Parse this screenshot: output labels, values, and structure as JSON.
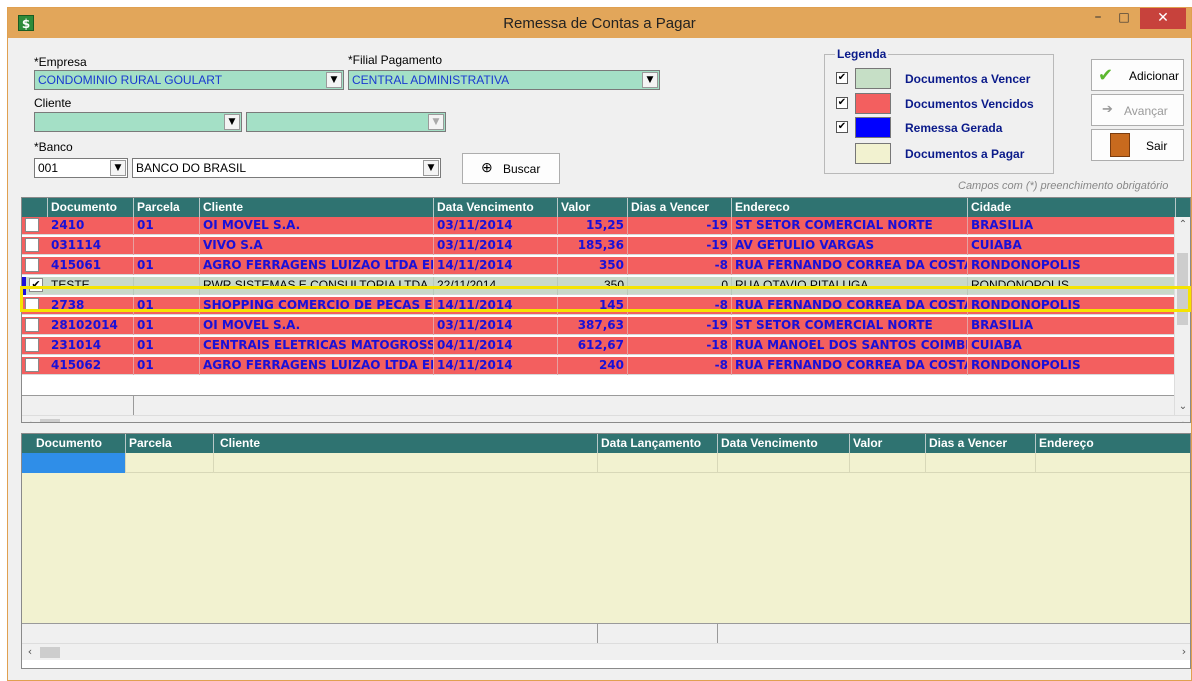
{
  "window": {
    "title": "Remessa de Contas a Pagar",
    "app_icon": "$",
    "minimize_label": "–",
    "maximize_label": "□",
    "close_label": "✕"
  },
  "form": {
    "empresa": {
      "label": "*Empresa",
      "value": "CONDOMINIO RURAL GOULART"
    },
    "filial": {
      "label": "*Filial Pagamento",
      "value": "CENTRAL ADMINISTRATIVA"
    },
    "cliente": {
      "label": "Cliente",
      "value": "",
      "value2": ""
    },
    "banco": {
      "label": "*Banco",
      "code": "001",
      "name": "BANCO DO BRASIL"
    },
    "buscar_label": "Buscar",
    "required_hint": "Campos com (*) preenchimento obrigatório"
  },
  "legend": {
    "title": "Legenda",
    "items": [
      {
        "label": "Documentos a Vencer",
        "color": "#c6dfc6",
        "checked": true
      },
      {
        "label": "Documentos Vencidos",
        "color": "#f35f5f",
        "checked": true
      },
      {
        "label": "Remessa Gerada",
        "color": "#0000ff",
        "checked": true
      },
      {
        "label": "Documentos a Pagar",
        "color": "#f2f2d0",
        "checked": false
      }
    ]
  },
  "actions": {
    "adicionar": "Adicionar",
    "avancar": "Avançar",
    "sair": "Sair"
  },
  "grid1": {
    "columns": [
      "Documento",
      "Parcela",
      "Cliente",
      "Data Vencimento",
      "Valor",
      "Dias a Vencer",
      "Endereco",
      "Cidade"
    ],
    "rows": [
      {
        "documento": "2410",
        "parcela": "01",
        "cliente": "OI MOVEL S.A.",
        "data_vencimento": "03/11/2014",
        "valor": "15,25",
        "dias": "-19",
        "endereco": "ST SETOR COMERCIAL NORTE",
        "cidade": "BRASILIA",
        "checked": false,
        "selected": false
      },
      {
        "documento": "031114",
        "parcela": "",
        "cliente": "VIVO S.A",
        "data_vencimento": "03/11/2014",
        "valor": "185,36",
        "dias": "-19",
        "endereco": "AV GETULIO VARGAS",
        "cidade": "CUIABA",
        "checked": false,
        "selected": false
      },
      {
        "documento": "415061",
        "parcela": "01",
        "cliente": "AGRO FERRAGENS LUIZAO LTDA EPP",
        "data_vencimento": "14/11/2014",
        "valor": "350",
        "dias": "-8",
        "endereco": "RUA FERNANDO CORREA DA COSTA",
        "cidade": "RONDONOPOLIS",
        "checked": false,
        "selected": false
      },
      {
        "documento": "TESTE",
        "parcela": "",
        "cliente": "RWR SISTEMAS E CONSULTORIA LTDA",
        "data_vencimento": "22/11/2014",
        "valor": "350",
        "dias": "0",
        "endereco": "RUA OTAVIO PITALUGA",
        "cidade": "RONDONOPOLIS",
        "checked": true,
        "selected": true
      },
      {
        "documento": "2738",
        "parcela": "01",
        "cliente": "SHOPPING COMERCIO DE PECAS E EQ",
        "data_vencimento": "14/11/2014",
        "valor": "145",
        "dias": "-8",
        "endereco": "RUA FERNANDO CORREA DA COSTA",
        "cidade": "RONDONOPOLIS",
        "checked": false,
        "selected": false
      },
      {
        "documento": "28102014",
        "parcela": "01",
        "cliente": "OI MOVEL S.A.",
        "data_vencimento": "03/11/2014",
        "valor": "387,63",
        "dias": "-19",
        "endereco": "ST SETOR COMERCIAL NORTE",
        "cidade": "BRASILIA",
        "checked": false,
        "selected": false
      },
      {
        "documento": "231014",
        "parcela": "01",
        "cliente": "CENTRAIS ELETRICAS MATOGROSSE",
        "data_vencimento": "04/11/2014",
        "valor": "612,67",
        "dias": "-18",
        "endereco": "RUA MANOEL DOS SANTOS COIMBRA",
        "cidade": "CUIABA",
        "checked": false,
        "selected": false
      },
      {
        "documento": "415062",
        "parcela": "01",
        "cliente": "AGRO FERRAGENS LUIZAO LTDA EPP",
        "data_vencimento": "14/11/2014",
        "valor": "240",
        "dias": "-8",
        "endereco": "RUA FERNANDO CORREA DA COSTA",
        "cidade": "RONDONOPOLIS",
        "checked": false,
        "selected": false
      }
    ]
  },
  "grid2": {
    "columns": [
      "Documento",
      "Parcela",
      "Cliente",
      "Data Lançamento",
      "Data Vencimento",
      "Valor",
      "Dias a Vencer",
      "Endereço"
    ]
  },
  "icons": {
    "check": "✔",
    "adicionar": "check-icon",
    "avancar": "forward-icon",
    "sair": "door-exit-icon",
    "buscar": "magnifier-icon"
  }
}
